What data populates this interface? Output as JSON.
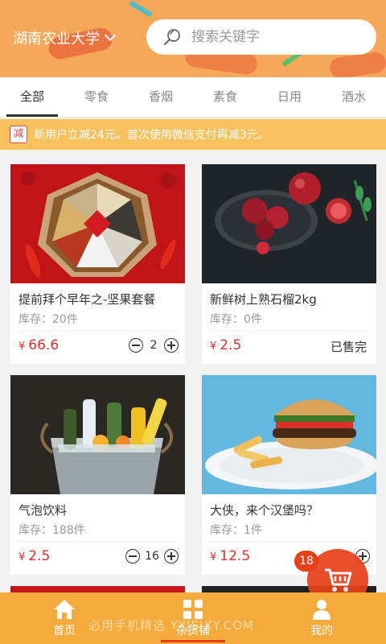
{
  "header": {
    "location": "湖南农业大学",
    "search_placeholder": "搜索关键字"
  },
  "tabs": [
    {
      "label": "全部",
      "active": true
    },
    {
      "label": "零食"
    },
    {
      "label": "香烟"
    },
    {
      "label": "素食"
    },
    {
      "label": "日用"
    },
    {
      "label": "酒水"
    }
  ],
  "notice": {
    "badge": "减",
    "text": "新用户立减24元。首次使用微信支付再减3元。"
  },
  "products": [
    {
      "name": "提前拜个早年之-坚果套餐",
      "stock": "库存：20件",
      "currency": "¥",
      "price": "66.6",
      "quantity": "2"
    },
    {
      "name": "新鲜树上熟石榴2kg",
      "stock": "库存：0件",
      "currency": "¥",
      "price": "2.5",
      "status": "已售完"
    },
    {
      "name": "气泡饮料",
      "stock": "库存：188件",
      "currency": "¥",
      "price": "2.5",
      "quantity": "16"
    },
    {
      "name": "大侠，来个汉堡吗？",
      "stock": "库存：1件",
      "currency": "¥",
      "price": "12.5"
    }
  ],
  "cart": {
    "count": "18"
  },
  "bottom_nav": [
    {
      "label": "首页",
      "icon": "home-icon"
    },
    {
      "label": "杂货铺",
      "icon": "grid-icon",
      "active": true
    },
    {
      "label": "我的",
      "icon": "user-icon"
    }
  ],
  "watermark": "必用手机精选 YYJSJXY.COM",
  "colors": {
    "accent": "#f5aa3c",
    "price": "#e52e2e",
    "cart": "#e8401a"
  }
}
